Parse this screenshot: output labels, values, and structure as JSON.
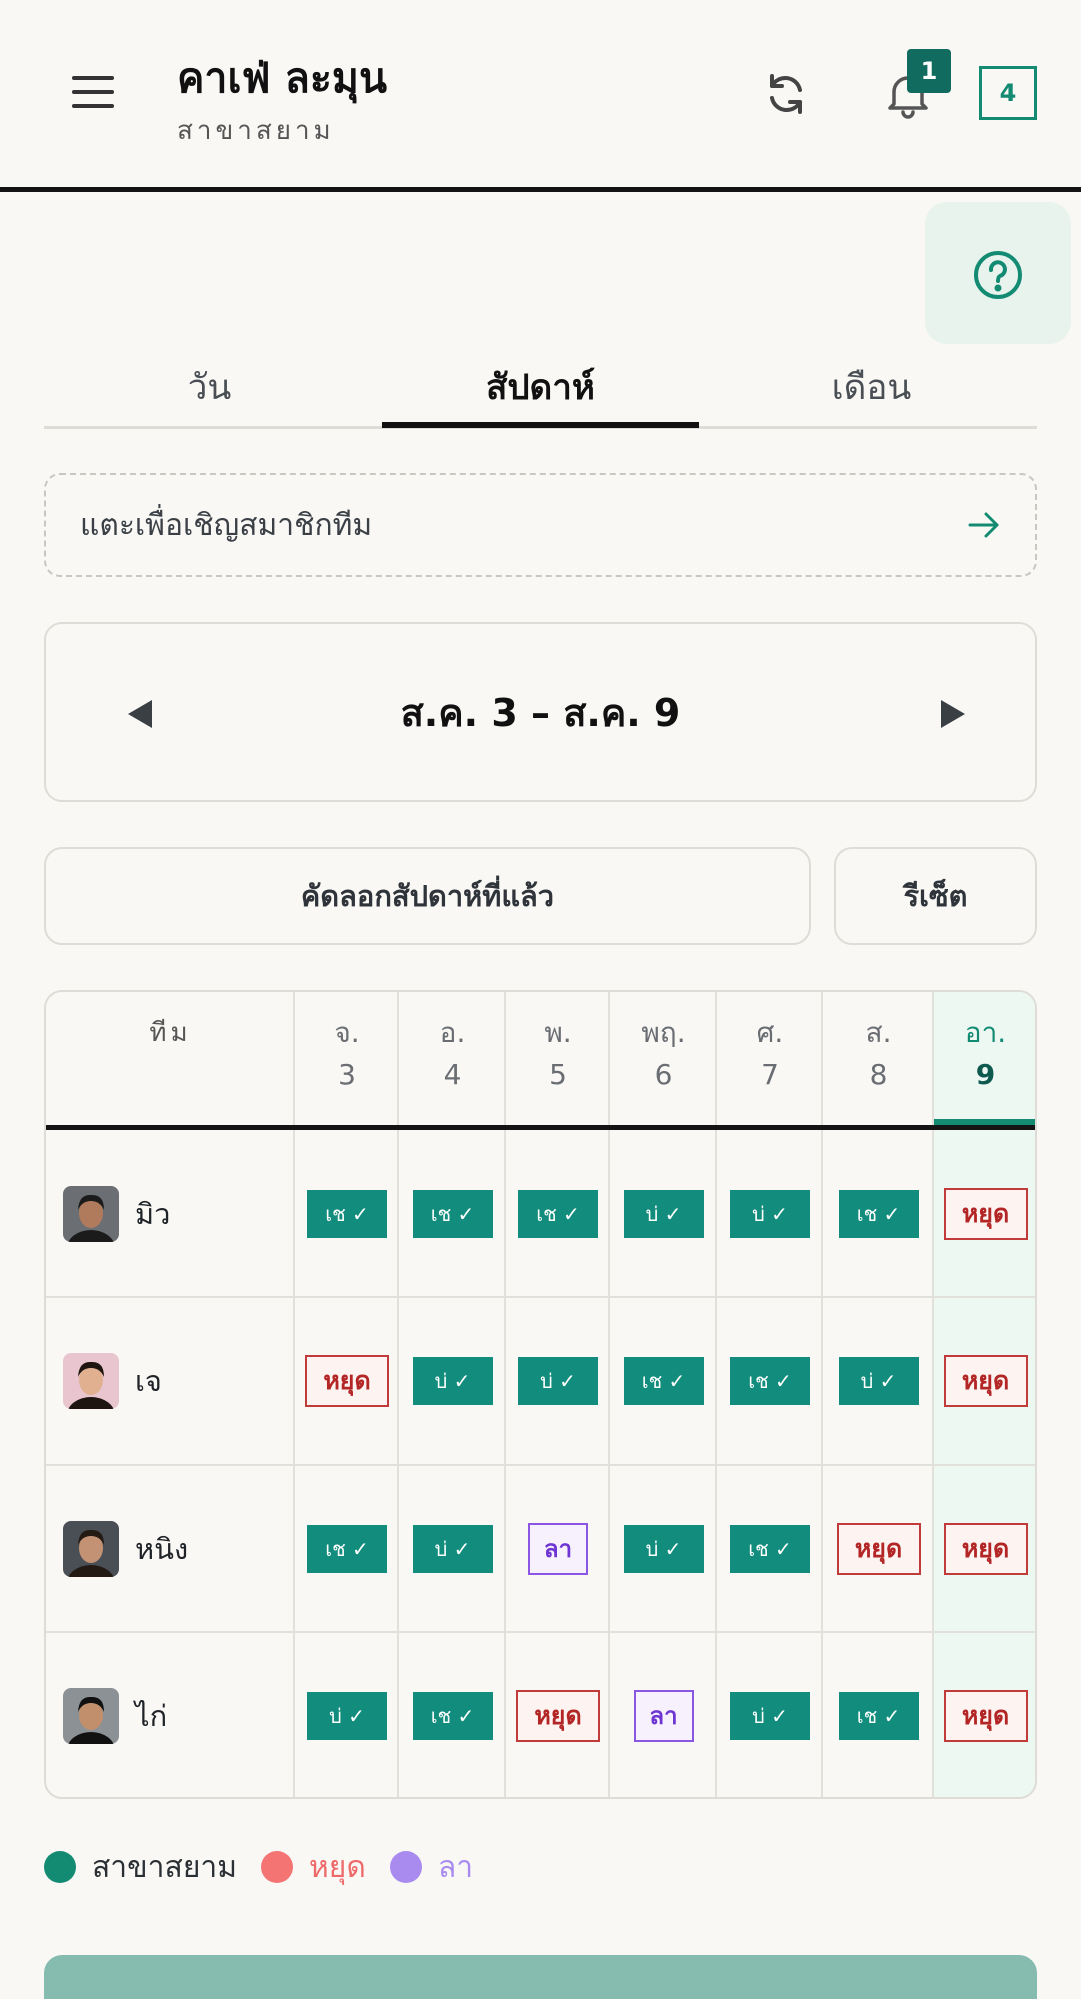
{
  "header": {
    "title": "คาเฟ่ ละมุน",
    "subtitle": "สาขาสยาม",
    "notification_count": "1",
    "box_count": "4"
  },
  "tabs": [
    {
      "label": "วัน",
      "active": false
    },
    {
      "label": "สัปดาห์",
      "active": true
    },
    {
      "label": "เดือน",
      "active": false
    }
  ],
  "invite": {
    "label": "แตะเพื่อเชิญสมาชิกทีม"
  },
  "week_nav": {
    "label": "ส.ค. 3 – ส.ค. 9"
  },
  "actions": {
    "copy_label": "คัดลอกสัปดาห์ที่แล้ว",
    "reset_label": "รีเซ็ต"
  },
  "schedule": {
    "team_header": "ทีม",
    "days": [
      {
        "name": "จ.",
        "num": "3"
      },
      {
        "name": "อ.",
        "num": "4"
      },
      {
        "name": "พ.",
        "num": "5"
      },
      {
        "name": "พฤ.",
        "num": "6"
      },
      {
        "name": "ศ.",
        "num": "7"
      },
      {
        "name": "ส.",
        "num": "8"
      },
      {
        "name": "อา.",
        "num": "9",
        "today": true
      }
    ],
    "members": [
      {
        "name": "มิว",
        "cells": [
          "เช ✓",
          "เช ✓",
          "เช ✓",
          "บ่ ✓",
          "บ่ ✓",
          "เช ✓",
          "หยุด"
        ],
        "kinds": [
          "shift",
          "shift",
          "shift",
          "shift",
          "shift",
          "shift",
          "off"
        ]
      },
      {
        "name": "เจ",
        "cells": [
          "หยุด",
          "บ่ ✓",
          "บ่ ✓",
          "เช ✓",
          "เช ✓",
          "บ่ ✓",
          "หยุด"
        ],
        "kinds": [
          "off",
          "shift",
          "shift",
          "shift",
          "shift",
          "shift",
          "off"
        ]
      },
      {
        "name": "หนิง",
        "cells": [
          "เช ✓",
          "บ่ ✓",
          "ลา",
          "บ่ ✓",
          "เช ✓",
          "หยุด",
          "หยุด"
        ],
        "kinds": [
          "shift",
          "shift",
          "leave",
          "shift",
          "shift",
          "off",
          "off"
        ]
      },
      {
        "name": "ไก่",
        "cells": [
          "บ่ ✓",
          "เช ✓",
          "หยุด",
          "ลา",
          "บ่ ✓",
          "เช ✓",
          "หยุด"
        ],
        "kinds": [
          "shift",
          "shift",
          "off",
          "leave",
          "shift",
          "shift",
          "off"
        ]
      }
    ]
  },
  "legend": [
    {
      "label": "สาขาสยาม",
      "color": "#138b73"
    },
    {
      "label": "หยุด",
      "color": "#f47373"
    },
    {
      "label": "ลา",
      "color": "#a98bf0"
    }
  ],
  "colors": {
    "accent": "#138b73",
    "shift": "#128c7c",
    "off": "#c23b3b",
    "leave": "#8a56e2"
  },
  "icons": {
    "menu": "hamburger-icon",
    "refresh": "refresh-icon",
    "bell": "bell-icon",
    "help": "question-circle-icon",
    "arrow": "arrow-right-icon"
  }
}
